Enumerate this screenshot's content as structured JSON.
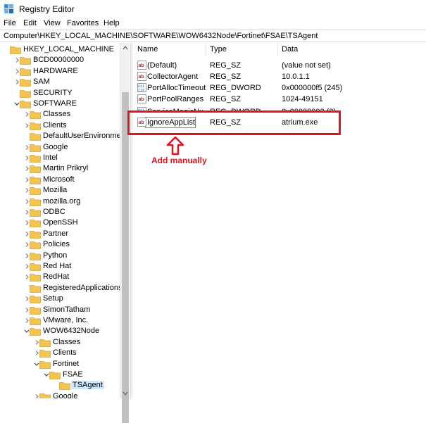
{
  "window": {
    "title": "Registry Editor"
  },
  "menu": [
    "File",
    "Edit",
    "View",
    "Favorites",
    "Help"
  ],
  "address": "Computer\\HKEY_LOCAL_MACHINE\\SOFTWARE\\WOW6432Node\\Fortinet\\FSAE\\TSAgent",
  "tree": [
    {
      "label": "HKEY_LOCAL_MACHINE",
      "depth": 0,
      "chev": "none"
    },
    {
      "label": "BCD00000000",
      "depth": 1,
      "chev": "right"
    },
    {
      "label": "HARDWARE",
      "depth": 1,
      "chev": "right"
    },
    {
      "label": "SAM",
      "depth": 1,
      "chev": "right"
    },
    {
      "label": "SECURITY",
      "depth": 1,
      "chev": "none"
    },
    {
      "label": "SOFTWARE",
      "depth": 1,
      "chev": "down"
    },
    {
      "label": "Classes",
      "depth": 2,
      "chev": "right"
    },
    {
      "label": "Clients",
      "depth": 2,
      "chev": "right"
    },
    {
      "label": "DefaultUserEnvironment",
      "depth": 2,
      "chev": "none"
    },
    {
      "label": "Google",
      "depth": 2,
      "chev": "right"
    },
    {
      "label": "Intel",
      "depth": 2,
      "chev": "right"
    },
    {
      "label": "Martin Prikryl",
      "depth": 2,
      "chev": "right"
    },
    {
      "label": "Microsoft",
      "depth": 2,
      "chev": "right"
    },
    {
      "label": "Mozilla",
      "depth": 2,
      "chev": "right"
    },
    {
      "label": "mozilla.org",
      "depth": 2,
      "chev": "right"
    },
    {
      "label": "ODBC",
      "depth": 2,
      "chev": "right"
    },
    {
      "label": "OpenSSH",
      "depth": 2,
      "chev": "right"
    },
    {
      "label": "Partner",
      "depth": 2,
      "chev": "right"
    },
    {
      "label": "Policies",
      "depth": 2,
      "chev": "right"
    },
    {
      "label": "Python",
      "depth": 2,
      "chev": "right"
    },
    {
      "label": "Red Hat",
      "depth": 2,
      "chev": "right"
    },
    {
      "label": "RedHat",
      "depth": 2,
      "chev": "right"
    },
    {
      "label": "RegisteredApplications",
      "depth": 2,
      "chev": "none"
    },
    {
      "label": "Setup",
      "depth": 2,
      "chev": "right"
    },
    {
      "label": "SimonTatham",
      "depth": 2,
      "chev": "right"
    },
    {
      "label": "VMware, Inc.",
      "depth": 2,
      "chev": "right"
    },
    {
      "label": "WOW6432Node",
      "depth": 2,
      "chev": "down"
    },
    {
      "label": "Classes",
      "depth": 3,
      "chev": "right"
    },
    {
      "label": "Clients",
      "depth": 3,
      "chev": "right"
    },
    {
      "label": "Fortinet",
      "depth": 3,
      "chev": "down"
    },
    {
      "label": "FSAE",
      "depth": 4,
      "chev": "down"
    },
    {
      "label": "TSAgent",
      "depth": 5,
      "chev": "none",
      "selected": true
    },
    {
      "label": "Google",
      "depth": 3,
      "chev": "right"
    }
  ],
  "columns": {
    "name": "Name",
    "type": "Type",
    "data": "Data"
  },
  "values": [
    {
      "icon": "ab",
      "name": "(Default)",
      "type": "REG_SZ",
      "data": "(value not set)"
    },
    {
      "icon": "ab",
      "name": "CollectorAgent",
      "type": "REG_SZ",
      "data": "10.0.1.1"
    },
    {
      "icon": "bin",
      "name": "PortAllocTimeout",
      "type": "REG_DWORD",
      "data": "0x000000f5 (245)"
    },
    {
      "icon": "ab",
      "name": "PortPoolRanges",
      "type": "REG_SZ",
      "data": "1024-49151"
    },
    {
      "icon": "bin",
      "name": "ServiceMagicNu",
      "type": "REG_DWORD",
      "data": "0x00000002 (2)",
      "clipped": true
    },
    {
      "icon": "ab",
      "name": "IgnoreAppList",
      "type": "REG_SZ",
      "data": "atrium.exe",
      "editing": true
    }
  ],
  "annotation": {
    "text": "Add manually",
    "color": "#e3141f"
  },
  "colors": {
    "folder": "#f2c454",
    "selection": "#cce8ff",
    "accent": "#e3141f"
  }
}
